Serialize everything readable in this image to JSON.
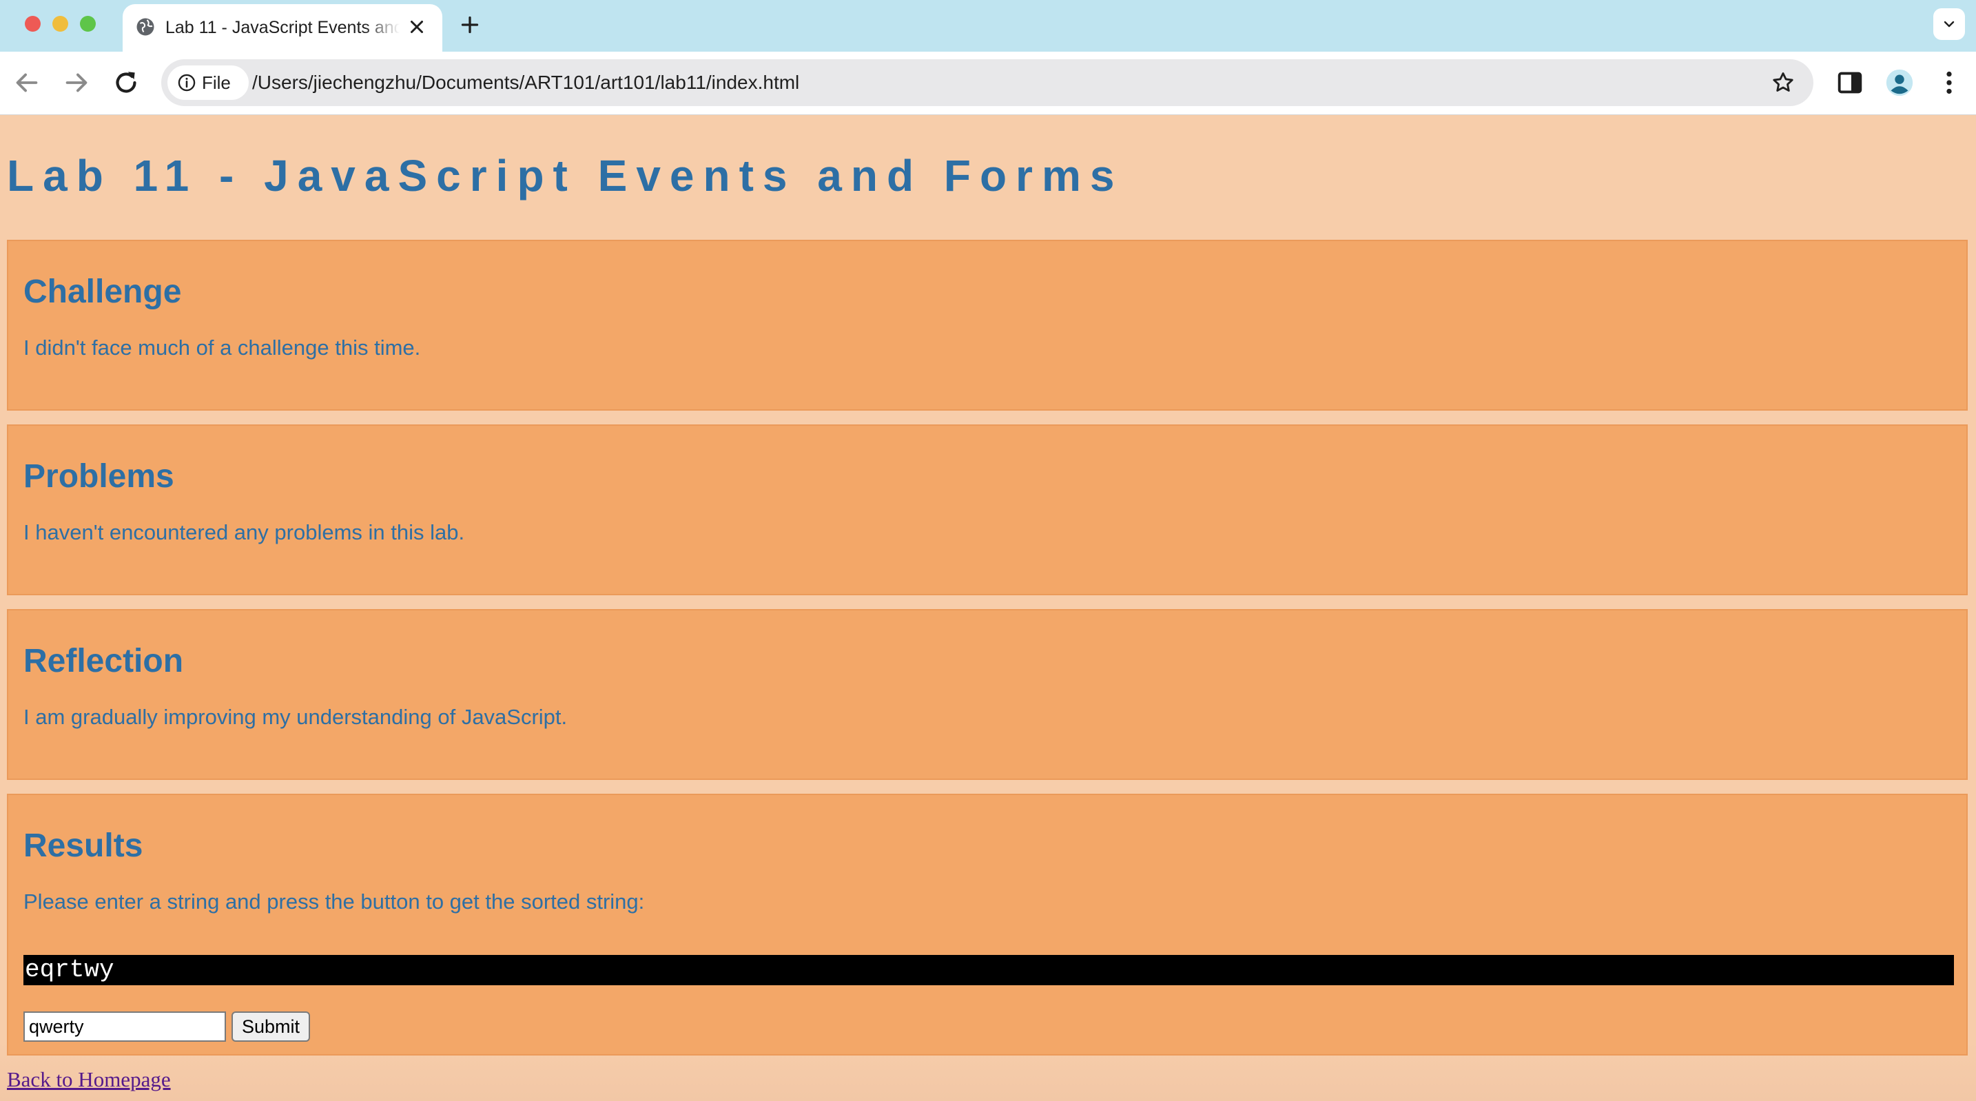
{
  "browser": {
    "tab_title": "Lab 11 - JavaScript Events and Forms",
    "chip_label": "File",
    "url": "/Users/jiechengzhu/Documents/ART101/art101/lab11/index.html"
  },
  "page": {
    "heading": "Lab 11 - JavaScript Events and Forms",
    "sections": [
      {
        "title": "Challenge",
        "text": "I didn't face much of a challenge this time."
      },
      {
        "title": "Problems",
        "text": "I haven't encountered any problems in this lab."
      },
      {
        "title": "Reflection",
        "text": "I am gradually improving my understanding of JavaScript."
      }
    ],
    "results": {
      "title": "Results",
      "prompt": "Please enter a string and press the button to get the sorted string:",
      "output": "eqrtwy",
      "input_value": "qwerty",
      "submit_label": "Submit"
    },
    "back_link": "Back to Homepage"
  },
  "colors": {
    "page_bg": "#f7cdaa",
    "section_bg": "#f3a768",
    "text_blue": "#2d6fa5"
  }
}
